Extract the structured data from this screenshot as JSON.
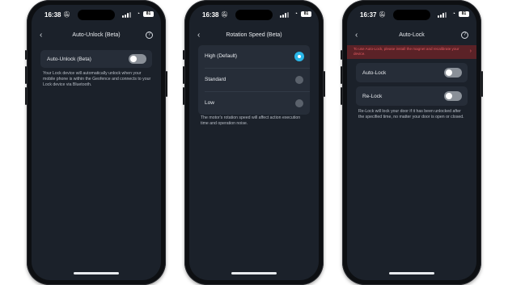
{
  "phones": [
    {
      "status": {
        "time": "16:38",
        "battery": "81"
      },
      "title": "Auto-Unlock (Beta)",
      "row_label": "Auto-Unlock (Beta)",
      "toggle_on": false,
      "description": "Your Lock device will automatically unlock when your mobile phone is within the Geofence and connects to your Lock device via Bluetooth."
    },
    {
      "status": {
        "time": "16:38",
        "battery": "81"
      },
      "title": "Rotation Speed (Beta)",
      "options": [
        "High (Default)",
        "Standard",
        "Low"
      ],
      "selected": "High (Default)",
      "description": "The motor's rotation speed will affect action execution time and operation noise."
    },
    {
      "status": {
        "time": "16:37",
        "battery": "81"
      },
      "title": "Auto-Lock",
      "banner": "To use Auto-Lock, please install the magnet and recalibrate your device.",
      "row1_label": "Auto-Lock",
      "row1_on": false,
      "row2_label": "Re-Lock",
      "row2_on": false,
      "description": "Re-Lock will lock your door if it has been unlocked after the specified time, no matter your door is open or closed."
    }
  ],
  "icons": {
    "back": "chevron-left-icon",
    "help": "help-icon",
    "bell": "silent-bell-icon",
    "wifi": "wifi-icon",
    "signal": "signal-icon",
    "battery": "battery-icon"
  },
  "colors": {
    "screen_bg": "#1b212a",
    "card_bg": "#262d38",
    "accent": "#2ab7e8",
    "warning_bg": "#5b2227",
    "warning_text": "#e45a60"
  }
}
